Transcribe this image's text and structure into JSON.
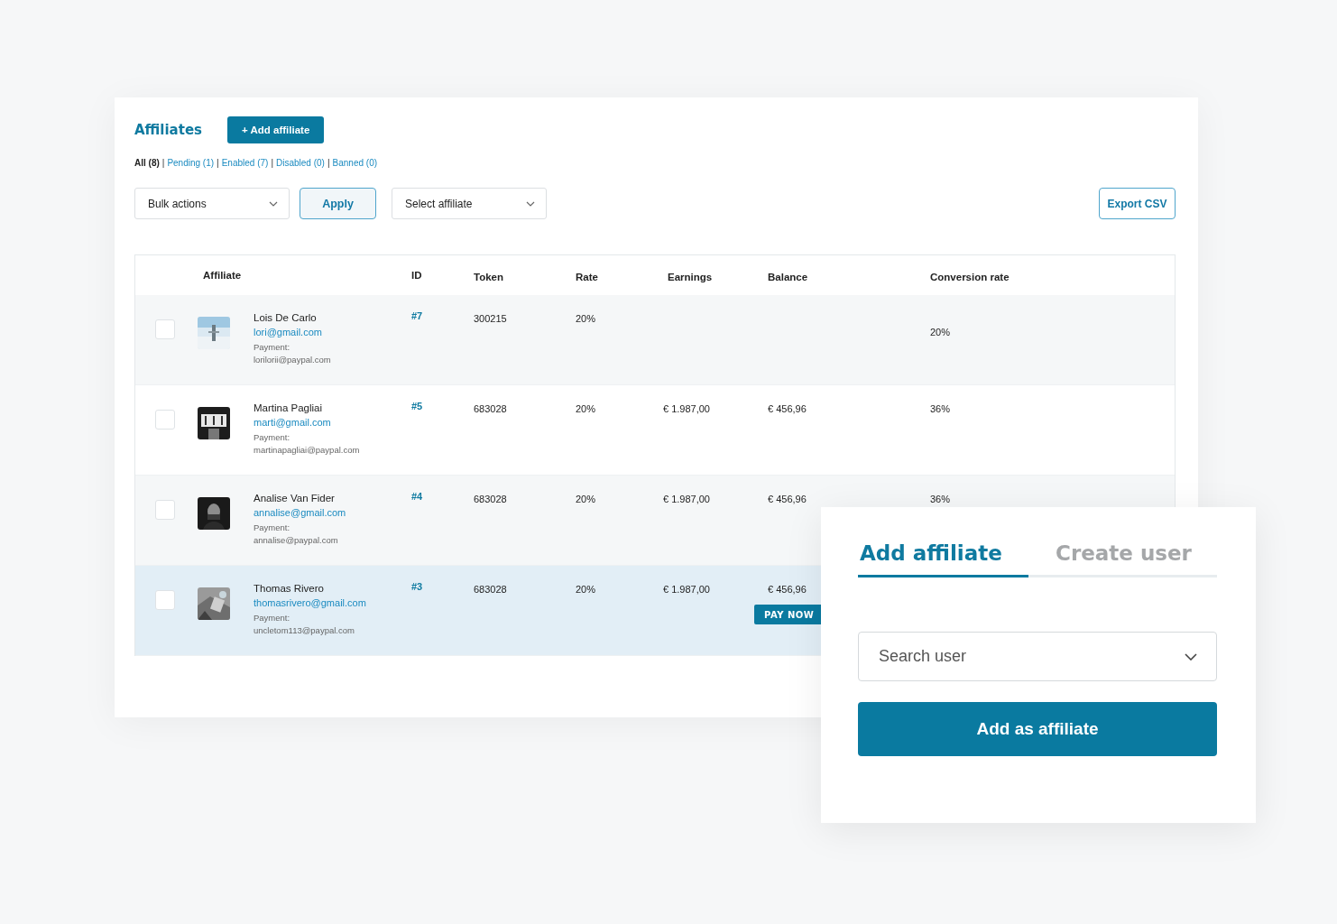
{
  "header": {
    "title": "Affiliates",
    "add_button": "+ Add affiliate"
  },
  "filters": {
    "separator": "|",
    "items": [
      {
        "label": "All (8)",
        "selected": true
      },
      {
        "label": "Pending (1)",
        "selected": false
      },
      {
        "label": "Enabled (7)",
        "selected": false
      },
      {
        "label": "Disabled (0)",
        "selected": false
      },
      {
        "label": "Banned (0)",
        "selected": false
      }
    ]
  },
  "toolbar": {
    "bulk_actions": "Bulk actions",
    "apply": "Apply",
    "select_affiliate": "Select affiliate",
    "export": "Export CSV"
  },
  "table": {
    "columns": [
      "Affiliate",
      "ID",
      "Token",
      "Rate",
      "Earnings",
      "Balance",
      "Conversion rate"
    ],
    "rows": [
      {
        "name": "Lois De Carlo",
        "email": "lori@gmail.com",
        "payment_label": "Payment:",
        "payment_email": "lorilorii@paypal.com",
        "id": "#7",
        "token": "300215",
        "rate": "20%",
        "conversion": "20%",
        "checked": false,
        "highlighted": false
      },
      {
        "name": "Martina Pagliai",
        "email": "marti@gmail.com",
        "payment_label": "Payment:",
        "payment_email": "martinapagliai@paypal.com",
        "id": "#5",
        "token": "683028",
        "rate": "20%",
        "earnings": "€ 1.987,00",
        "balance": "€ 456,96",
        "conversion": "36%",
        "checked": false,
        "highlighted": false
      },
      {
        "name": "Analise Van Fider",
        "email": "annalise@gmail.com",
        "payment_label": "Payment:",
        "payment_email": "annalise@paypal.com",
        "id": "#4",
        "token": "683028",
        "rate": "20%",
        "earnings": "€ 1.987,00",
        "balance": "€ 456,96",
        "conversion": "36%",
        "checked": false,
        "highlighted": false
      },
      {
        "name": "Thomas Rivero",
        "email": "thomasrivero@gmail.com",
        "payment_label": "Payment:",
        "payment_email": "uncletom113@paypal.com",
        "id": "#3",
        "token": "683028",
        "rate": "20%",
        "earnings": "€ 1.987,00",
        "balance": "€ 456,96",
        "action": "PAY NOW",
        "checked": false,
        "highlighted": true
      }
    ]
  },
  "dialog": {
    "tabs": [
      {
        "label": "Add affiliate",
        "selected": true
      },
      {
        "label": "Create user",
        "selected": false
      }
    ],
    "search": {
      "placeholder": "Search user"
    },
    "submit": "Add as affiliate"
  }
}
